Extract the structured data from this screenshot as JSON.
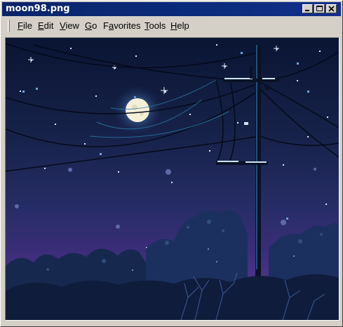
{
  "window": {
    "title": "moon98.png",
    "controls": [
      "minimize-icon",
      "maximize-icon",
      "close-icon"
    ]
  },
  "menu": {
    "items": [
      {
        "label": "File",
        "mnemonic": "F",
        "rest": "ile"
      },
      {
        "label": "Edit",
        "mnemonic": "E",
        "rest": "dit"
      },
      {
        "label": "View",
        "mnemonic": "V",
        "rest": "iew"
      },
      {
        "label": "Go",
        "mnemonic": "G",
        "rest": "o"
      },
      {
        "label": "Favorites",
        "mnemonic": "a",
        "pre": "F",
        "rest": "vorites"
      },
      {
        "label": "Tools",
        "mnemonic": "T",
        "rest": "ools"
      },
      {
        "label": "Help",
        "mnemonic": "H",
        "rest": "elp"
      }
    ]
  },
  "image": {
    "subject": "night-sky-pixel-art",
    "colors": {
      "sky_top": "#0b1738",
      "sky_mid": "#1e2858",
      "sky_low": "#3d2a78",
      "horizon": "#5a3a8c",
      "trees": "#1a2e55",
      "moon": "#f4f0d8",
      "glow": "#7fb2e0",
      "pole": "#0a1226"
    }
  }
}
